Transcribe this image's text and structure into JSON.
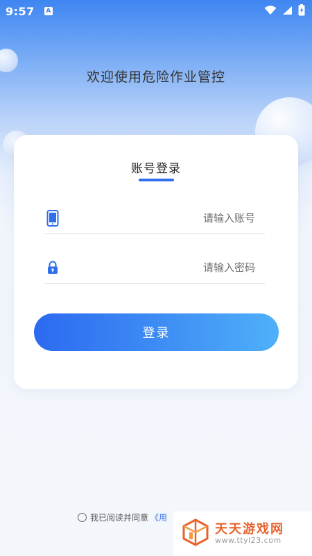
{
  "status_bar": {
    "time": "9:57",
    "notification_icon_letter": "A",
    "icons": [
      "wifi-icon",
      "signal-icon",
      "battery-icon"
    ]
  },
  "header": {
    "welcome_text": "欢迎使用危险作业管控"
  },
  "login_card": {
    "tab_label": "账号登录",
    "account_field": {
      "placeholder": "请输入账号",
      "value": "",
      "icon": "phone-icon"
    },
    "password_field": {
      "placeholder": "请输入密码",
      "value": "",
      "icon": "lock-icon"
    },
    "login_button_label": "登录"
  },
  "agreement": {
    "prefix": "我已阅读并同意",
    "link_partial": "《用"
  },
  "watermark": {
    "title": "天天游戏网",
    "url": "www.ttyl23.com"
  },
  "colors": {
    "accent": "#2f6fee",
    "header_top": "#3f86f2",
    "button_start": "#2c6af0",
    "button_end": "#4fb0f9",
    "watermark_orange": "#e8622b"
  }
}
